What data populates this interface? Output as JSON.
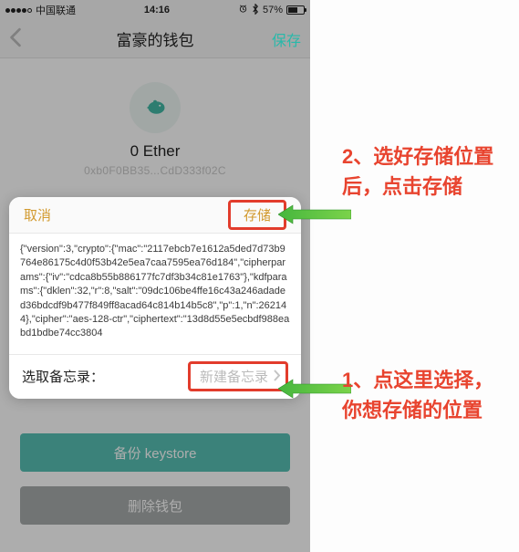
{
  "statusbar": {
    "carrier": "中国联通",
    "time": "14:16",
    "battery_pct": "57%"
  },
  "navbar": {
    "title": "富豪的钱包",
    "save": "保存"
  },
  "wallet": {
    "balance": "0 Ether",
    "address": "0xb0F0BB35...CdD333f02C"
  },
  "buttons": {
    "backup": "备份 keystore",
    "delete": "删除钱包"
  },
  "sheet": {
    "cancel": "取消",
    "store": "存储",
    "json_text": "{\"version\":3,\"crypto\":{\"mac\":\"2117ebcb7e1612a5ded7d73b9764e86175c4d0f53b42e5ea7caa7595ea76d184\",\"cipherparams\":{\"iv\":\"cdca8b55b886177fc7df3b34c81e1763\"},\"kdfparams\":{\"dklen\":32,\"r\":8,\"salt\":\"09dc106be4ffe16c43a246adaded36bdcdf9b477f849ff8acad64c814b14b5c8\",\"p\":1,\"n\":262144},\"cipher\":\"aes-128-ctr\",\"ciphertext\":\"13d8d55e5ecbdf988eabd1bdbe74cc3804",
    "memo_label": "选取备忘录：",
    "memo_placeholder": "新建备忘录"
  },
  "annotations": {
    "a1": "1、点这里选择，你想存储的位置",
    "a2": "2、选好存储位置后，点击存储"
  },
  "icons": {
    "back": "back-chevron-icon",
    "alarm": "alarm-icon",
    "bluetooth": "bluetooth-icon",
    "wallet": "fish-wallet-icon",
    "chevron_right": "chevron-right-icon"
  },
  "colors": {
    "accent": "#28b9aa",
    "highlight": "#e23c2c",
    "amber": "#d29a2f"
  }
}
